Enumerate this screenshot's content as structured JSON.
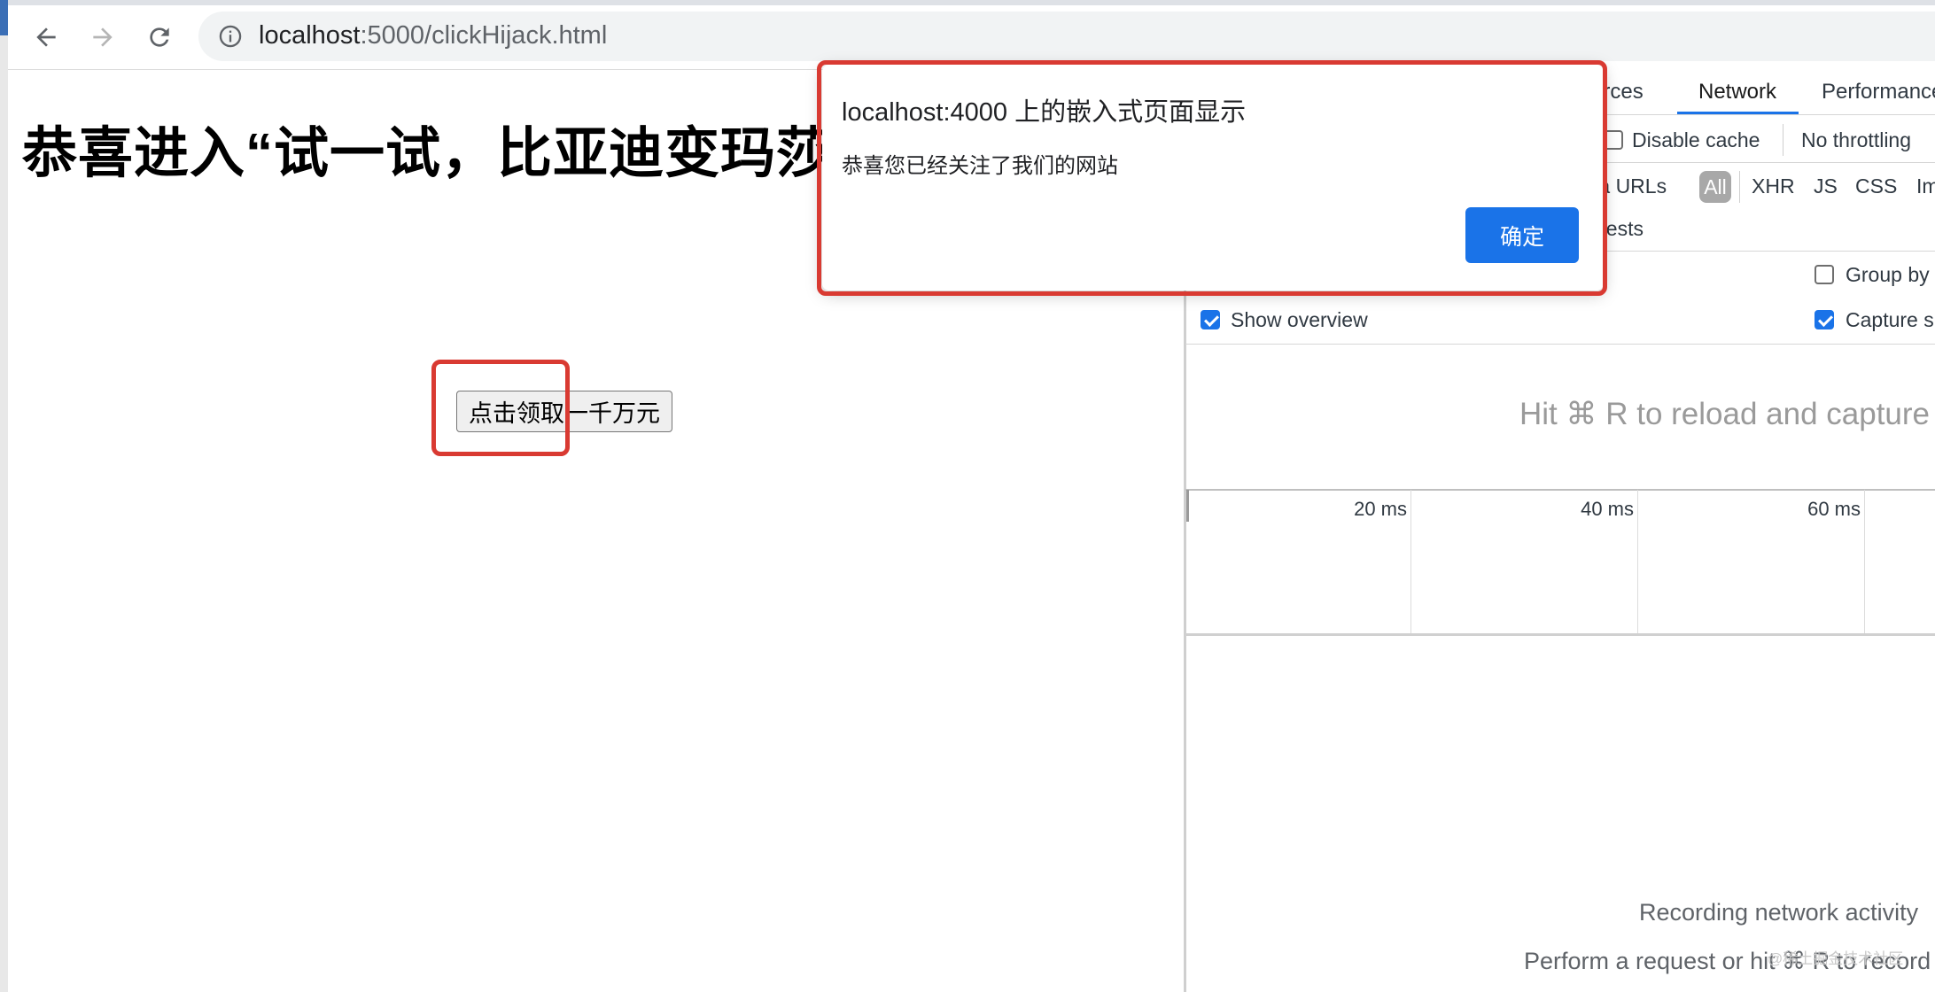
{
  "browser": {
    "url_host": "localhost",
    "url_path": ":5000/clickHijack.html"
  },
  "page": {
    "heading": "恭喜进入“试一试，比亚迪变玛莎",
    "button_label": "点击领取一千万元"
  },
  "dialog": {
    "title": "localhost:4000 上的嵌入式页面显示",
    "message": "恭喜您已经关注了我们的网站",
    "ok_label": "确定"
  },
  "devtools": {
    "tabs": [
      "urces",
      "Network",
      "Performance"
    ],
    "active_tab": "Network",
    "disable_cache_label": "Disable cache",
    "throttling_label": "No throttling",
    "filter_partial_label": "ta URLs",
    "filter_types": [
      "All",
      "XHR",
      "JS",
      "CSS",
      "Im"
    ],
    "requests_partial_label": "uests",
    "group_by_label": "Group by",
    "show_overview_label": "Show overview",
    "capture_label": "Capture s",
    "reload_hint": "Hit ⌘ R to reload and capture",
    "timeline_ticks": [
      "20 ms",
      "40 ms",
      "60 ms"
    ],
    "recording_text": "Recording network activity",
    "perform_text": "Perform a request or hit ⌘ R to record"
  },
  "watermark": "@稀土掘金技术社区",
  "colors": {
    "accent": "#1a73e8",
    "highlight_box": "#d93a32"
  }
}
